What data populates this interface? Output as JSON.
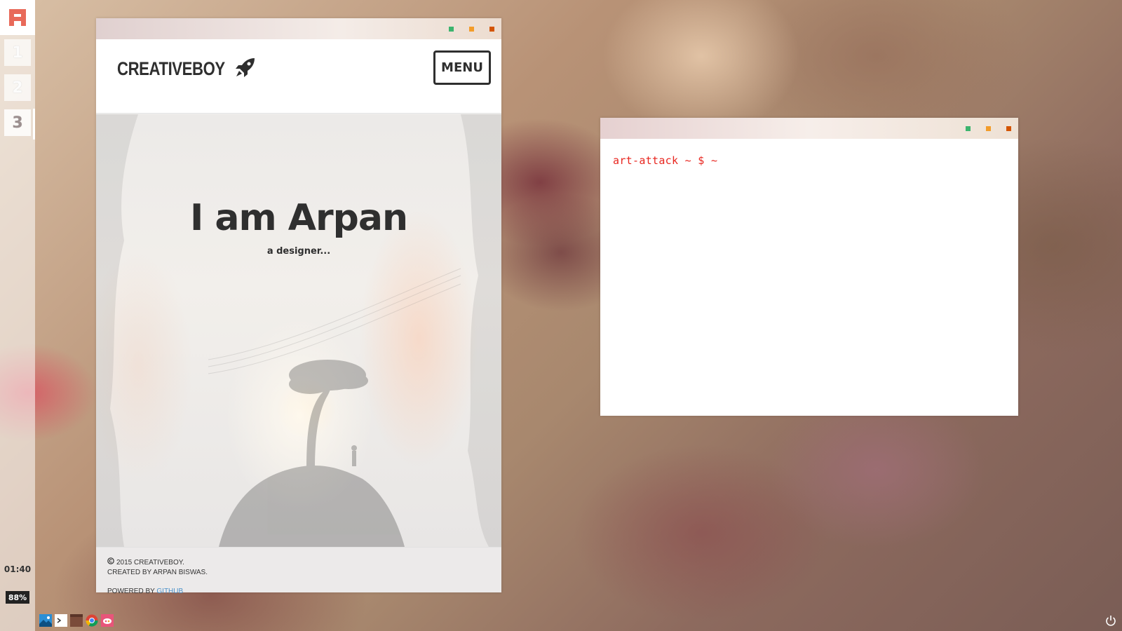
{
  "dock": {
    "logo_icon": "app-logo-icon",
    "workspaces": [
      {
        "label": "1",
        "active": false
      },
      {
        "label": "2",
        "active": false
      },
      {
        "label": "3",
        "active": true
      }
    ],
    "clock": "01:40",
    "battery": "88%"
  },
  "browser_window": {
    "controls": [
      {
        "name": "maximize",
        "color": "#3cb46e"
      },
      {
        "name": "minimize",
        "color": "#f39c2a"
      },
      {
        "name": "close",
        "color": "#d35400"
      }
    ],
    "site": {
      "brand": "CREATIVEBOY",
      "brand_icon": "rocket-icon",
      "menu_label": "MENU",
      "hero_title": "I am Arpan",
      "hero_subtitle": "a designer...",
      "footer": {
        "copyright_icon": "copyright-icon",
        "copyright": "2015 CREATIVEBOY.",
        "created_by": "CREATED BY ARPAN BISWAS.",
        "powered_by": "POWERED BY",
        "powered_link": "GITHUB",
        "link_color": "#4a90c8"
      }
    }
  },
  "terminal_window": {
    "controls": [
      {
        "name": "maximize",
        "color": "#3cb46e"
      },
      {
        "name": "minimize",
        "color": "#f39c2a"
      },
      {
        "name": "close",
        "color": "#d35400"
      }
    ],
    "prompt": "art-attack ~ $ ~",
    "prompt_color": "#e8261f"
  },
  "taskbar": {
    "icons": [
      "image-viewer-icon",
      "terminal-icon",
      "file-manager-icon",
      "chrome-icon",
      "paint-icon"
    ],
    "power_icon": "power-icon"
  }
}
